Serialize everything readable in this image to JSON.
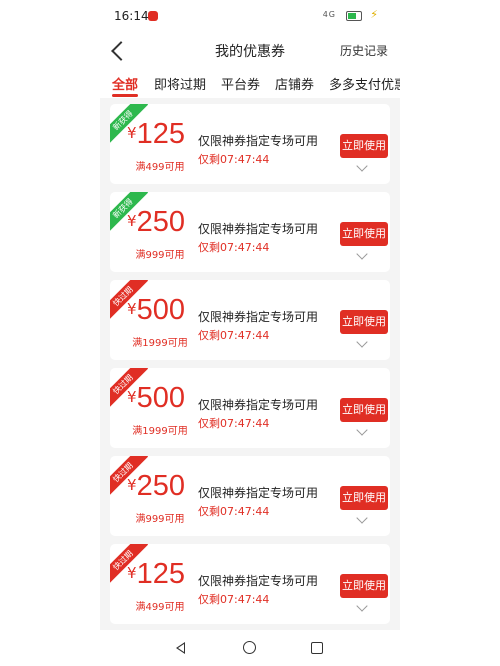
{
  "status": {
    "time": "16:14",
    "network": "4G",
    "battery": "29"
  },
  "header": {
    "title": "我的优惠券",
    "history": "历史记录"
  },
  "tabs": [
    "全部",
    "即将过期",
    "平台券",
    "店铺券",
    "多多支付优惠"
  ],
  "coupons": [
    {
      "ribbon": "新获得",
      "amount": "125",
      "currency": "¥",
      "condition": "满499可用",
      "name": "仅限神券指定专场可用",
      "remaining": "仅剩07:47:44",
      "button": "立即使用"
    },
    {
      "ribbon": "新获得",
      "amount": "250",
      "currency": "¥",
      "condition": "满999可用",
      "name": "仅限神券指定专场可用",
      "remaining": "仅剩07:47:44",
      "button": "立即使用"
    },
    {
      "ribbon": "快过期",
      "amount": "500",
      "currency": "¥",
      "condition": "满1999可用",
      "name": "仅限神券指定专场可用",
      "remaining": "仅剩07:47:44",
      "button": "立即使用"
    },
    {
      "ribbon": "快过期",
      "amount": "500",
      "currency": "¥",
      "condition": "满1999可用",
      "name": "仅限神券指定专场可用",
      "remaining": "仅剩07:47:44",
      "button": "立即使用"
    },
    {
      "ribbon": "快过期",
      "amount": "250",
      "currency": "¥",
      "condition": "满999可用",
      "name": "仅限神券指定专场可用",
      "remaining": "仅剩07:47:44",
      "button": "立即使用"
    },
    {
      "ribbon": "快过期",
      "amount": "125",
      "currency": "¥",
      "condition": "满499可用",
      "name": "仅限神券指定专场可用",
      "remaining": "仅剩07:47:44",
      "button": "立即使用"
    }
  ],
  "icons": {
    "back": "chevron-left-icon",
    "expand": "chevron-down-icon",
    "nav_back": "triangle-back-icon",
    "nav_home": "circle-home-icon",
    "nav_recent": "square-recent-icon"
  },
  "colors": {
    "accent": "#e02e24",
    "new_ribbon": "#2db84d",
    "expire_ribbon": "#e02e24"
  }
}
